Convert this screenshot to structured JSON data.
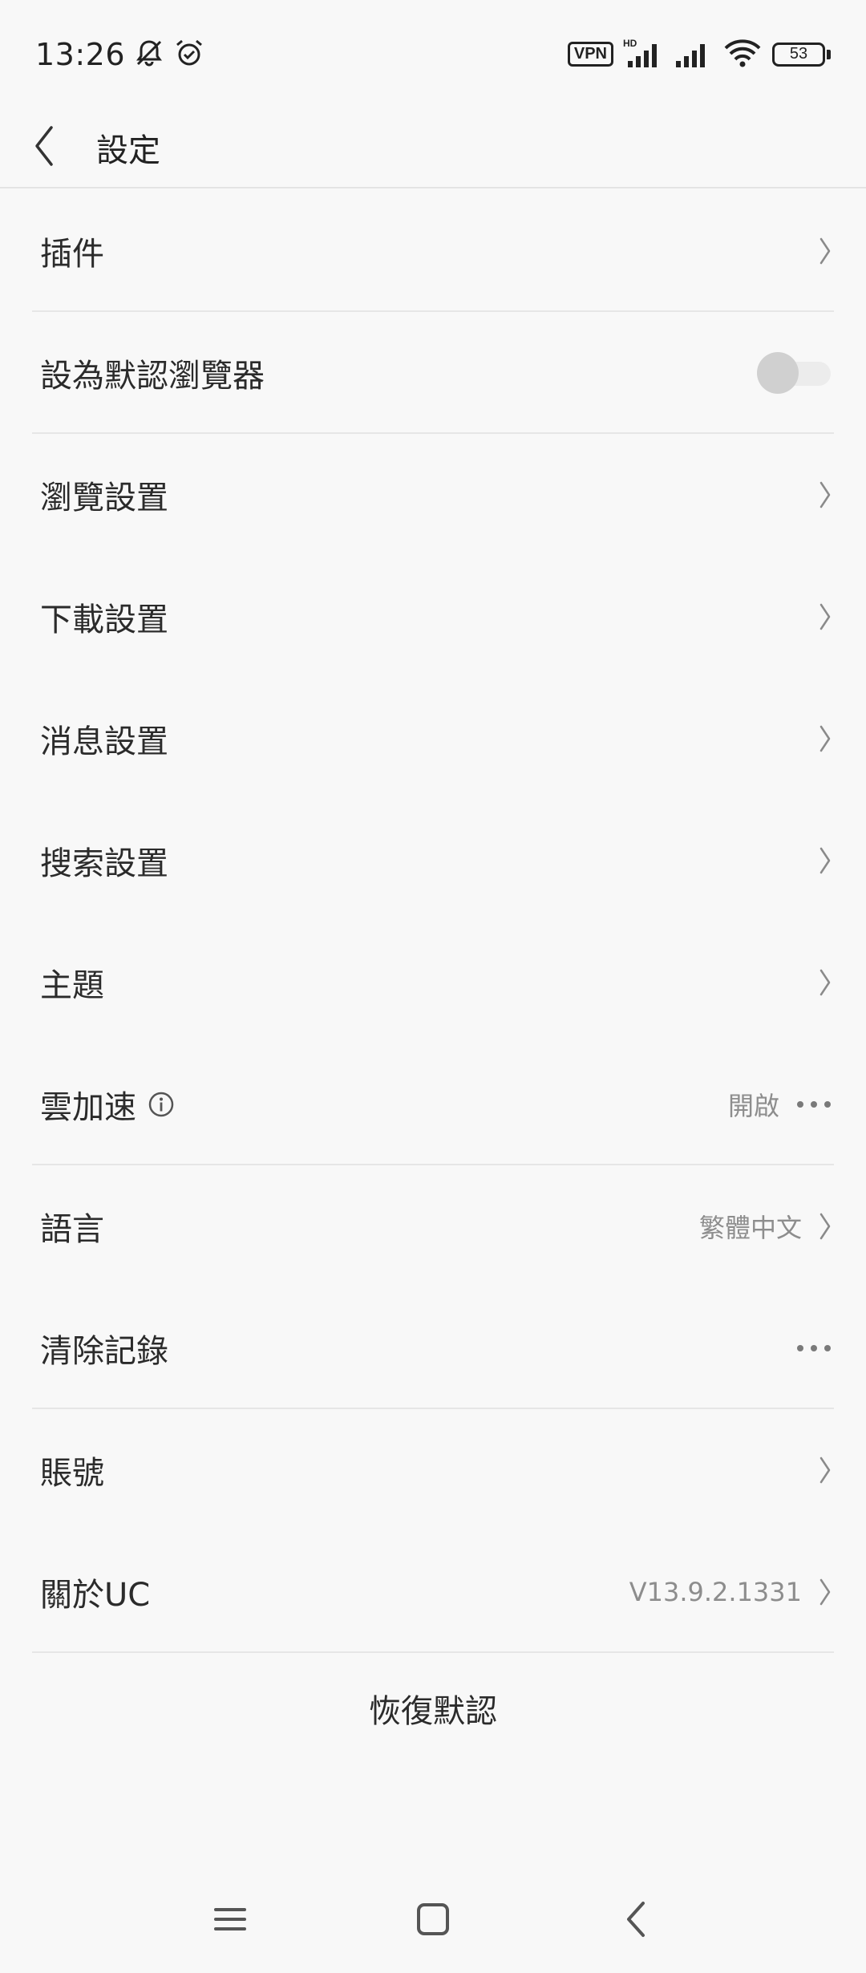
{
  "status_bar": {
    "time": "13:26",
    "vpn": "VPN",
    "battery": "53",
    "icons": [
      "bell-off-icon",
      "alarm-icon",
      "hd-signal-icon",
      "signal-icon",
      "wifi-icon",
      "battery-icon"
    ]
  },
  "header": {
    "title": "設定",
    "back_icon": "chevron-left-icon"
  },
  "settings": {
    "items": [
      {
        "label": "插件"
      },
      {
        "label": "設為默認瀏覽器",
        "toggle": false
      },
      {
        "label": "瀏覽設置"
      },
      {
        "label": "下載設置"
      },
      {
        "label": "消息設置"
      },
      {
        "label": "搜索設置"
      },
      {
        "label": "主題"
      },
      {
        "label": "雲加速",
        "value": "開啟"
      },
      {
        "label": "語言",
        "value": "繁體中文"
      },
      {
        "label": "清除記錄"
      },
      {
        "label": "賬號"
      },
      {
        "label": "關於UC",
        "value": "V13.9.2.1331"
      }
    ]
  },
  "restore": {
    "label": "恢復默認"
  },
  "nav_bar": {
    "icons": [
      "menu-icon",
      "home-icon",
      "back-icon"
    ]
  },
  "colors": {
    "background": "#f8f8f8",
    "text": "#2b2b2b",
    "secondary_text": "#8d8d8d",
    "divider": "#e6e6e6"
  }
}
